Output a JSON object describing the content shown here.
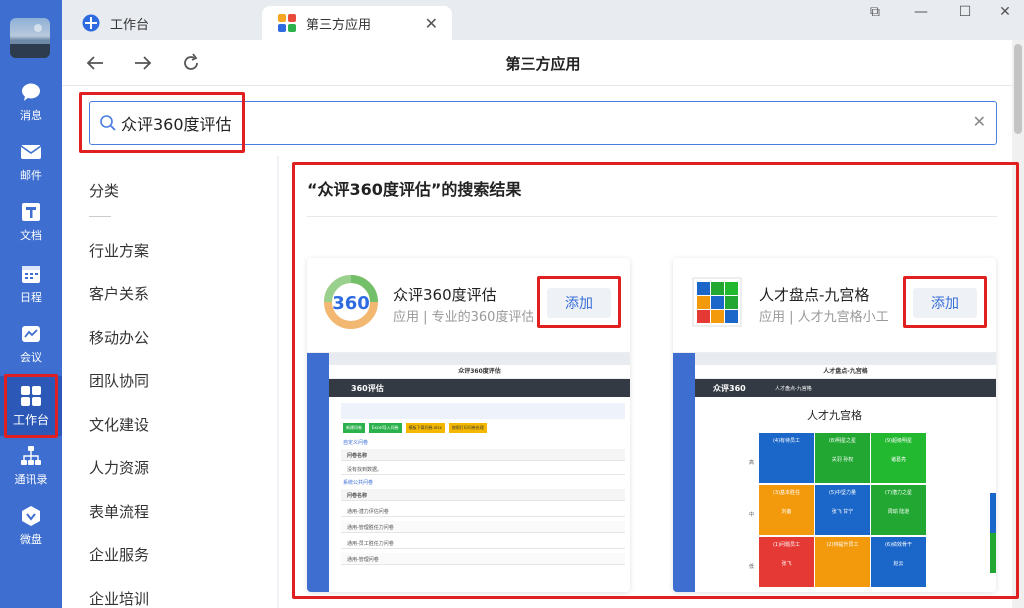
{
  "rail": {
    "items": [
      {
        "label": "消息",
        "icon": "chat-icon"
      },
      {
        "label": "邮件",
        "icon": "mail-icon"
      },
      {
        "label": "文档",
        "icon": "document-icon"
      },
      {
        "label": "日程",
        "icon": "calendar-icon"
      },
      {
        "label": "会议",
        "icon": "meeting-icon"
      },
      {
        "label": "工作台",
        "icon": "workbench-icon"
      },
      {
        "label": "通讯录",
        "icon": "contacts-icon"
      },
      {
        "label": "微盘",
        "icon": "cloud-drive-icon"
      }
    ],
    "active_index": 5,
    "bg_color": "#3e6fd0"
  },
  "tabs": [
    {
      "label": "工作台",
      "icon": "workbench-icon"
    },
    {
      "label": "第三方应用",
      "icon": "apps-icon",
      "active": true
    }
  ],
  "nav": {
    "title": "第三方应用"
  },
  "search": {
    "value": "众评360度评估",
    "placeholder": ""
  },
  "categories": {
    "header": "分类",
    "items": [
      "行业方案",
      "客户关系",
      "移动办公",
      "团队协同",
      "文化建设",
      "人力资源",
      "表单流程",
      "企业服务",
      "企业培训"
    ]
  },
  "results": {
    "title": "“众评360度评估”的搜索结果",
    "cards": [
      {
        "name": "众评360度评估",
        "desc": "应用 | 专业的360度评估",
        "add_label": "添加",
        "logo_text": "360",
        "preview": {
          "page_title": "众评360度评估",
          "brand": "360评估",
          "section1": "自定义问卷",
          "row_empty": "没有找到数据。",
          "section2": "系统公共问卷",
          "col_header": "问卷名称",
          "rows": [
            "通用-潜力评估问卷",
            "通用-管理胜任力问卷",
            "通用-员工胜任力问卷",
            "通用-管理问卷"
          ],
          "buttons": [
            "新建问卷",
            "Excel导入问卷",
            "模板下载问卷.xlsx",
            "按照打印问卷处理"
          ]
        }
      },
      {
        "name": "人才盘点-九宫格",
        "desc": "应用 | 人才九宫格小工",
        "add_label": "添加",
        "preview": {
          "page_title": "人才盘点-九宫格",
          "brand": "众评360",
          "sub": "人才盘点-九宫格",
          "heading": "人才九宫格",
          "axis_rows": [
            "高",
            "中",
            "低"
          ],
          "cells": [
            {
              "label": "(4)有待员工",
              "sub": "",
              "color": "#1a66c9"
            },
            {
              "label": "(8)明星之星",
              "sub": "关羽 孙权",
              "color": "#22a832"
            },
            {
              "label": "(9)超级明星",
              "sub": "诸葛亮",
              "color": "#22b830"
            },
            {
              "label": "(3)基本胜任",
              "sub": "刘备",
              "color": "#f29a0c"
            },
            {
              "label": "(5)中坚力量",
              "sub": "张飞 甘宁",
              "color": "#1a66c9"
            },
            {
              "label": "(7)潜力之星",
              "sub": "周瑜 陆逊",
              "color": "#22a832"
            },
            {
              "label": "(1)问题员工",
              "sub": "张飞",
              "color": "#e53935"
            },
            {
              "label": "(2)待提升员工",
              "sub": "",
              "color": "#f29a0c"
            },
            {
              "label": "(6)绩效骨干",
              "sub": "赵云",
              "color": "#1a66c9"
            }
          ]
        }
      }
    ]
  }
}
